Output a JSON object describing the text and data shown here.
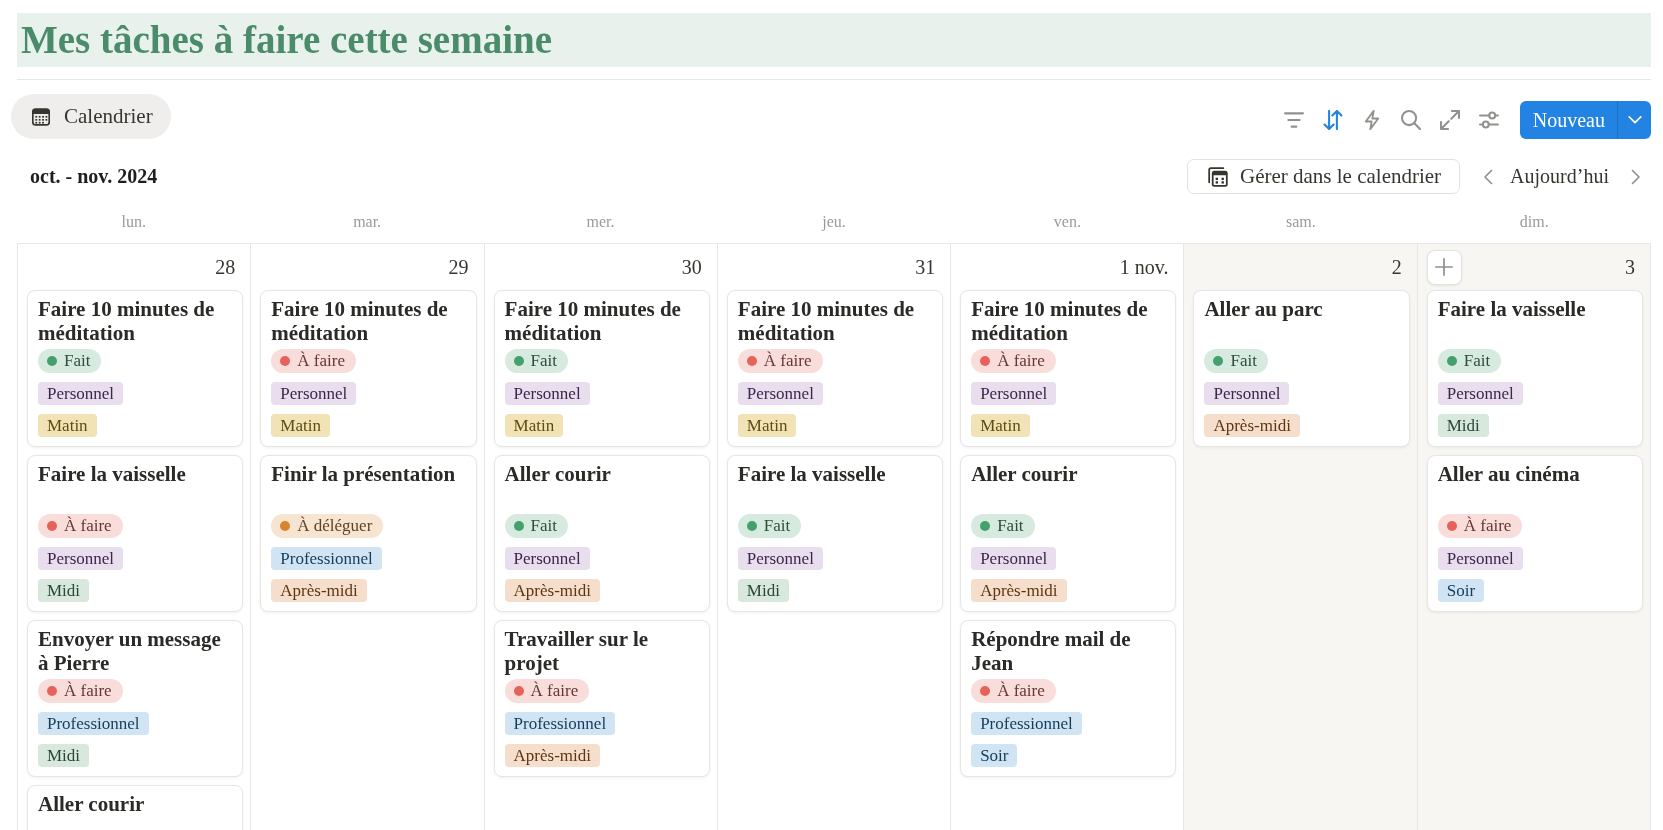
{
  "page_title": "Mes tâches à faire cette semaine",
  "views": [
    {
      "label": "Calendrier",
      "selected": true
    }
  ],
  "toolbar": [
    {
      "kind": "filter",
      "active": false
    },
    {
      "kind": "sort",
      "active": true
    },
    {
      "kind": "automation",
      "active": false
    },
    {
      "kind": "search",
      "active": false
    },
    {
      "kind": "expand",
      "active": false
    },
    {
      "kind": "settings",
      "active": false
    }
  ],
  "new_button": {
    "label": "Nouveau"
  },
  "calendar": {
    "period": "oct. - nov. 2024",
    "manage_button": "Gérer dans le calendrier",
    "today_button": "Aujourd’hui",
    "columns": [
      {
        "weekday": "lun.",
        "day": "28",
        "weekend": false,
        "hovered": false,
        "cards": [
          {
            "title": "Faire 10 minutes de méditation",
            "status": {
              "label": "Fait",
              "color": "#45a16c"
            },
            "tags": [
              {
                "label": "Personnel",
                "color": "#e8deee"
              },
              {
                "label": "Matin",
                "color": "#f1e3b6"
              }
            ]
          },
          {
            "title": "Faire la vaisselle",
            "status": {
              "label": "À faire",
              "color": "#e5635a"
            },
            "tags": [
              {
                "label": "Personnel",
                "color": "#e8deee"
              },
              {
                "label": "Midi",
                "color": "#d8e8dd"
              }
            ]
          },
          {
            "title": "Envoyer un message à Pierre",
            "status": {
              "label": "À faire",
              "color": "#e5635a"
            },
            "tags": [
              {
                "label": "Professionnel",
                "color": "#d0e4f4"
              },
              {
                "label": "Midi",
                "color": "#d8e8dd"
              }
            ]
          },
          {
            "title": "Aller courir"
          }
        ]
      },
      {
        "weekday": "mar.",
        "day": "29",
        "weekend": false,
        "hovered": false,
        "cards": [
          {
            "title": "Faire 10 minutes de méditation",
            "status": {
              "label": "À faire",
              "color": "#e5635a"
            },
            "tags": [
              {
                "label": "Personnel",
                "color": "#e8deee"
              },
              {
                "label": "Matin",
                "color": "#f1e3b6"
              }
            ]
          },
          {
            "title": "Finir la présentation",
            "status": {
              "label": "À déléguer",
              "color": "#d9822f"
            },
            "tags": [
              {
                "label": "Professionnel",
                "color": "#d0e4f4"
              },
              {
                "label": "Après-midi",
                "color": "#f5dfcc"
              }
            ]
          }
        ]
      },
      {
        "weekday": "mer.",
        "day": "30",
        "weekend": false,
        "hovered": false,
        "cards": [
          {
            "title": "Faire 10 minutes de méditation",
            "status": {
              "label": "Fait",
              "color": "#45a16c"
            },
            "tags": [
              {
                "label": "Personnel",
                "color": "#e8deee"
              },
              {
                "label": "Matin",
                "color": "#f1e3b6"
              }
            ]
          },
          {
            "title": "Aller courir",
            "status": {
              "label": "Fait",
              "color": "#45a16c"
            },
            "tags": [
              {
                "label": "Personnel",
                "color": "#e8deee"
              },
              {
                "label": "Après-midi",
                "color": "#f5dfcc"
              }
            ]
          },
          {
            "title": "Travailler sur le projet",
            "status": {
              "label": "À faire",
              "color": "#e5635a"
            },
            "tags": [
              {
                "label": "Professionnel",
                "color": "#d0e4f4"
              },
              {
                "label": "Après-midi",
                "color": "#f5dfcc"
              }
            ]
          }
        ]
      },
      {
        "weekday": "jeu.",
        "day": "31",
        "weekend": false,
        "hovered": false,
        "cards": [
          {
            "title": "Faire 10 minutes de méditation",
            "status": {
              "label": "À faire",
              "color": "#e5635a"
            },
            "tags": [
              {
                "label": "Personnel",
                "color": "#e8deee"
              },
              {
                "label": "Matin",
                "color": "#f1e3b6"
              }
            ]
          },
          {
            "title": "Faire la vaisselle",
            "status": {
              "label": "Fait",
              "color": "#45a16c"
            },
            "tags": [
              {
                "label": "Personnel",
                "color": "#e8deee"
              },
              {
                "label": "Midi",
                "color": "#d8e8dd"
              }
            ]
          }
        ]
      },
      {
        "weekday": "ven.",
        "day": "1 nov.",
        "weekend": false,
        "hovered": false,
        "cards": [
          {
            "title": "Faire 10 minutes de méditation",
            "status": {
              "label": "À faire",
              "color": "#e5635a"
            },
            "tags": [
              {
                "label": "Personnel",
                "color": "#e8deee"
              },
              {
                "label": "Matin",
                "color": "#f1e3b6"
              }
            ]
          },
          {
            "title": "Aller courir",
            "status": {
              "label": "Fait",
              "color": "#45a16c"
            },
            "tags": [
              {
                "label": "Personnel",
                "color": "#e8deee"
              },
              {
                "label": "Après-midi",
                "color": "#f5dfcc"
              }
            ]
          },
          {
            "title": "Répondre mail de Jean",
            "status": {
              "label": "À faire",
              "color": "#e5635a"
            },
            "tags": [
              {
                "label": "Professionnel",
                "color": "#d0e4f4"
              },
              {
                "label": "Soir",
                "color": "#d0e4f4"
              }
            ]
          }
        ]
      },
      {
        "weekday": "sam.",
        "day": "2",
        "weekend": true,
        "hovered": false,
        "cards": [
          {
            "title": "Aller au parc",
            "status": {
              "label": "Fait",
              "color": "#45a16c"
            },
            "tags": [
              {
                "label": "Personnel",
                "color": "#e8deee"
              },
              {
                "label": "Après-midi",
                "color": "#f5dfcc"
              }
            ]
          }
        ]
      },
      {
        "weekday": "dim.",
        "day": "3",
        "weekend": true,
        "hovered": true,
        "cards": [
          {
            "title": "Faire la vaisselle",
            "status": {
              "label": "Fait",
              "color": "#45a16c"
            },
            "tags": [
              {
                "label": "Personnel",
                "color": "#e8deee"
              },
              {
                "label": "Midi",
                "color": "#d8e8dd"
              }
            ]
          },
          {
            "title": "Aller au cinéma",
            "status": {
              "label": "À faire",
              "color": "#e5635a"
            },
            "tags": [
              {
                "label": "Personnel",
                "color": "#e8deee"
              },
              {
                "label": "Soir",
                "color": "#d0e4f4"
              }
            ]
          }
        ]
      }
    ]
  }
}
